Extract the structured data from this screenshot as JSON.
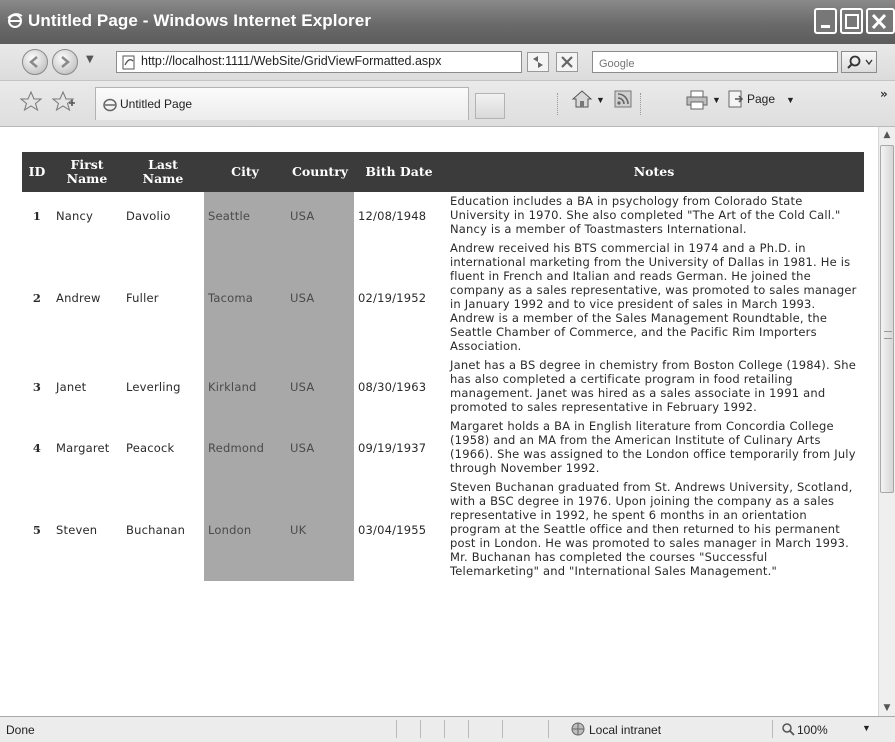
{
  "window": {
    "title": "Untitled Page - Windows Internet Explorer"
  },
  "address": {
    "url": "http://localhost:1111/WebSite/GridViewFormatted.aspx",
    "search_placeholder": "Google"
  },
  "tab": {
    "label": "Untitled Page"
  },
  "commands": {
    "page_label": "Page"
  },
  "grid": {
    "headers": [
      "ID",
      "First Name",
      "Last Name",
      "City",
      "Country",
      "Bith Date",
      "Notes"
    ],
    "rows": [
      {
        "id": "1",
        "first": "Nancy",
        "last": "Davolio",
        "city": "Seattle",
        "country": "USA",
        "birth": "12/08/1948",
        "notes": "Education includes a BA in psychology from Colorado State University in 1970. She also completed \"The Art of the Cold Call.\" Nancy is a member of Toastmasters International."
      },
      {
        "id": "2",
        "first": "Andrew",
        "last": "Fuller",
        "city": "Tacoma",
        "country": "USA",
        "birth": "02/19/1952",
        "notes": "Andrew received his BTS commercial in 1974 and a Ph.D. in international marketing from the University of Dallas in 1981. He is fluent in French and Italian and reads German. He joined the company as a sales representative, was promoted to sales manager in January 1992 and to vice president of sales in March 1993. Andrew is a member of the Sales Management Roundtable, the Seattle Chamber of Commerce, and the Pacific Rim Importers Association."
      },
      {
        "id": "3",
        "first": "Janet",
        "last": "Leverling",
        "city": "Kirkland",
        "country": "USA",
        "birth": "08/30/1963",
        "notes": "Janet has a BS degree in chemistry from Boston College (1984). She has also completed a certificate program in food retailing management. Janet was hired as a sales associate in 1991 and promoted to sales representative in February 1992."
      },
      {
        "id": "4",
        "first": "Margaret",
        "last": "Peacock",
        "city": "Redmond",
        "country": "USA",
        "birth": "09/19/1937",
        "notes": "Margaret holds a BA in English literature from Concordia College (1958) and an MA from the American Institute of Culinary Arts (1966). She was assigned to the London office temporarily from July through November 1992."
      },
      {
        "id": "5",
        "first": "Steven",
        "last": "Buchanan",
        "city": "London",
        "country": "UK",
        "birth": "03/04/1955",
        "notes": "Steven Buchanan graduated from St. Andrews University, Scotland, with a BSC degree in 1976. Upon joining the company as a sales representative in 1992, he spent 6 months in an orientation program at the Seattle office and then returned to his permanent post in London. He was promoted to sales manager in March 1993. Mr. Buchanan has completed the courses \"Successful Telemarketing\" and \"International Sales Management.\""
      }
    ]
  },
  "status": {
    "left": "Done",
    "zone": "Local intranet",
    "zoom": "100%"
  },
  "icons": [
    "ie-logo-icon",
    "minimize-icon",
    "maximize-icon",
    "close-icon",
    "back-icon",
    "forward-icon",
    "page-icon",
    "refresh-icon",
    "stop-icon",
    "search-icon",
    "favorites-star-icon",
    "add-favorites-icon",
    "home-icon",
    "feeds-icon",
    "print-icon",
    "page-menu-icon",
    "globe-icon",
    "zoom-icon"
  ]
}
